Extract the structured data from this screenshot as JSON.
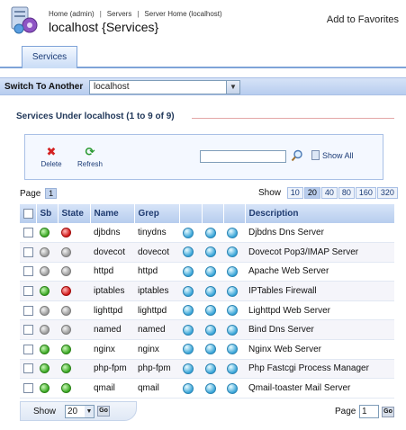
{
  "header": {
    "breadcrumbs": [
      "Home (admin)",
      "Servers",
      "Server Home (localhost)"
    ],
    "breadcrumb_sep": "|",
    "title": "localhost {Services}",
    "favorites": "Add to Favorites"
  },
  "tabs": [
    {
      "label": "Services",
      "active": true
    }
  ],
  "switch": {
    "label": "Switch To Another",
    "value": "localhost"
  },
  "section": {
    "title": "Services Under localhost (1 to 9 of 9)"
  },
  "toolbar": {
    "delete": "Delete",
    "refresh": "Refresh",
    "search_value": "",
    "show_all": "Show All"
  },
  "pager": {
    "page_label": "Page",
    "current_page": "1",
    "show_label": "Show",
    "sizes": [
      "10",
      "20",
      "40",
      "80",
      "160",
      "320"
    ],
    "active_size": "20"
  },
  "grid": {
    "columns": [
      "Sb",
      "State",
      "Name",
      "Grep",
      "Description"
    ],
    "rows": [
      {
        "sb": "green",
        "state": "red",
        "name": "djbdns",
        "grep": "tinydns",
        "desc": "Djbdns Dns Server"
      },
      {
        "sb": "gray",
        "state": "gray",
        "name": "dovecot",
        "grep": "dovecot",
        "desc": "Dovecot Pop3/IMAP Server"
      },
      {
        "sb": "gray",
        "state": "gray",
        "name": "httpd",
        "grep": "httpd",
        "desc": "Apache Web Server"
      },
      {
        "sb": "green",
        "state": "red",
        "name": "iptables",
        "grep": "iptables",
        "desc": "IPTables Firewall"
      },
      {
        "sb": "gray",
        "state": "gray",
        "name": "lighttpd",
        "grep": "lighttpd",
        "desc": "Lighttpd Web Server"
      },
      {
        "sb": "gray",
        "state": "gray",
        "name": "named",
        "grep": "named",
        "desc": "Bind Dns Server"
      },
      {
        "sb": "green",
        "state": "green",
        "name": "nginx",
        "grep": "nginx",
        "desc": "Nginx Web Server"
      },
      {
        "sb": "green",
        "state": "green",
        "name": "php-fpm",
        "grep": "php-fpm",
        "desc": "Php Fastcgi Process Manager"
      },
      {
        "sb": "green",
        "state": "green",
        "name": "qmail",
        "grep": "qmail",
        "desc": "Qmail-toaster Mail Server"
      }
    ]
  },
  "footer": {
    "show_label": "Show",
    "show_value": "20",
    "go": "Go",
    "page_label": "Page",
    "page_value": "1"
  },
  "colors": {
    "accent": "#7ea3d8",
    "header_bg": "#b7cdee",
    "status_green": "#3aa823",
    "status_red": "#d11818",
    "status_gray": "#9a9a9a"
  }
}
